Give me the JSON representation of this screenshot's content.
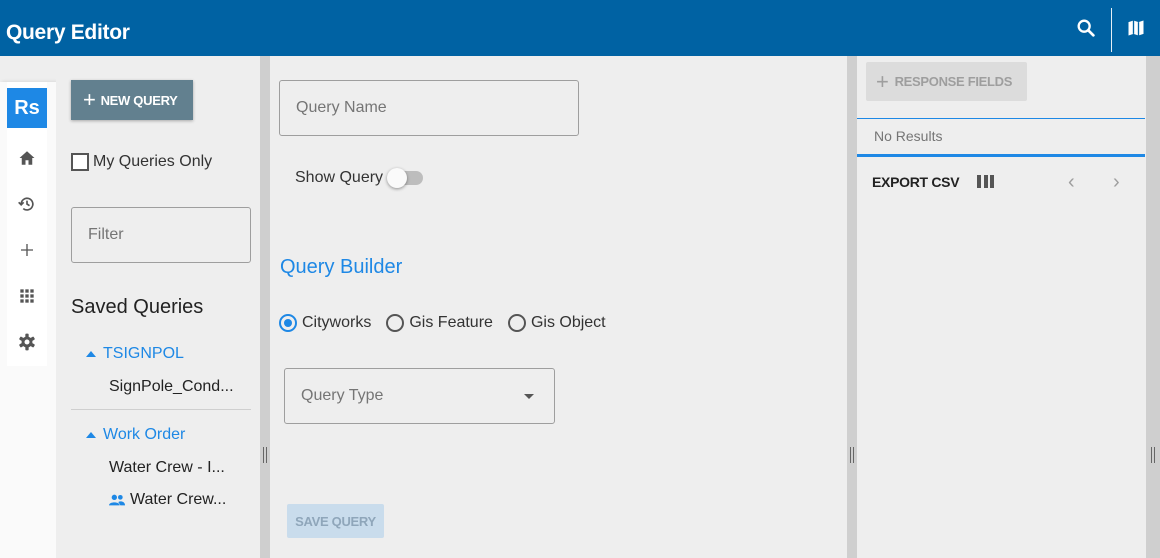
{
  "header": {
    "title": "Query Editor",
    "icons": [
      "search-icon",
      "map-icon"
    ]
  },
  "rail": {
    "logo": "Rs",
    "items": [
      "home-icon",
      "history-icon",
      "add-icon",
      "apps-icon",
      "settings-icon"
    ]
  },
  "sidebar": {
    "new_query_label": "NEW QUERY",
    "my_queries_label": "My Queries Only",
    "filter_placeholder": "Filter",
    "saved_title": "Saved Queries",
    "groups": [
      {
        "name": "TSIGNPOL",
        "items": [
          "SignPole_Cond..."
        ]
      },
      {
        "name": "Work Order",
        "items": [
          "Water Crew - I...",
          "Water Crew..."
        ]
      }
    ]
  },
  "editor": {
    "query_name_placeholder": "Query Name",
    "show_query_label": "Show Query",
    "show_query_on": false,
    "builder_title": "Query Builder",
    "radio_options": [
      "Cityworks",
      "Gis Feature",
      "Gis Object"
    ],
    "radio_selected": "Cityworks",
    "query_type_placeholder": "Query Type",
    "save_label": "SAVE QUERY"
  },
  "results": {
    "response_fields_label": "RESPONSE FIELDS",
    "no_results": "No Results",
    "export_label": "EXPORT CSV"
  },
  "colors": {
    "header": "#0062a3",
    "accent": "#1e88e5",
    "new_query_button": "#62808f"
  }
}
